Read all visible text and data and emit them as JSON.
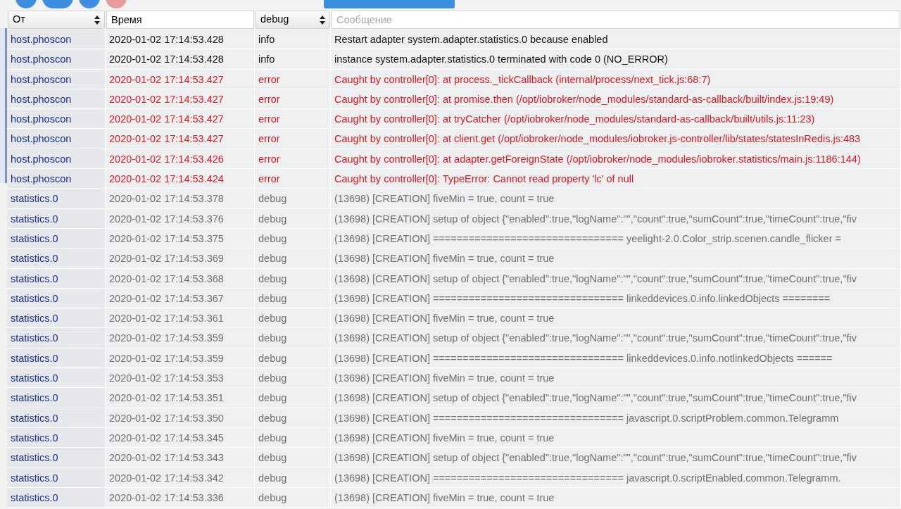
{
  "toolbar": {
    "buttons": [
      {
        "kind": "round",
        "color": "#3c8fe0"
      },
      {
        "kind": "pill",
        "color": "#3c8fe0"
      },
      {
        "kind": "round",
        "color": "#3c8fe0"
      },
      {
        "kind": "round",
        "color": "#e89a9a"
      },
      {
        "kind": "wide",
        "color": "#3c8fe0"
      }
    ]
  },
  "filters": {
    "source": {
      "value": "От"
    },
    "time": {
      "value": "Время"
    },
    "severity": {
      "value": "debug"
    },
    "message": {
      "placeholder": "Сообщение"
    }
  },
  "rows": [
    {
      "source": "host.phoscon",
      "time": "2020-01-02 17:14:53.428",
      "severity": "info",
      "message": "Restart adapter system.adapter.statistics.0 because enabled"
    },
    {
      "source": "host.phoscon",
      "time": "2020-01-02 17:14:53.428",
      "severity": "info",
      "message": "instance system.adapter.statistics.0 terminated with code 0 (NO_ERROR)"
    },
    {
      "source": "host.phoscon",
      "time": "2020-01-02 17:14:53.427",
      "severity": "error",
      "message": "Caught by controller[0]: at process._tickCallback (internal/process/next_tick.js:68:7)"
    },
    {
      "source": "host.phoscon",
      "time": "2020-01-02 17:14:53.427",
      "severity": "error",
      "message": "Caught by controller[0]: at promise.then (/opt/iobroker/node_modules/standard-as-callback/built/index.js:19:49)"
    },
    {
      "source": "host.phoscon",
      "time": "2020-01-02 17:14:53.427",
      "severity": "error",
      "message": "Caught by controller[0]: at tryCatcher (/opt/iobroker/node_modules/standard-as-callback/built/utils.js:11:23)"
    },
    {
      "source": "host.phoscon",
      "time": "2020-01-02 17:14:53.427",
      "severity": "error",
      "message": "Caught by controller[0]: at client.get (/opt/iobroker/node_modules/iobroker.js-controller/lib/states/statesInRedis.js:483"
    },
    {
      "source": "host.phoscon",
      "time": "2020-01-02 17:14:53.426",
      "severity": "error",
      "message": "Caught by controller[0]: at adapter.getForeignState (/opt/iobroker/node_modules/iobroker.statistics/main.js:1186:144)"
    },
    {
      "source": "host.phoscon",
      "time": "2020-01-02 17:14:53.424",
      "severity": "error",
      "message": "Caught by controller[0]: TypeError: Cannot read property 'lc' of null"
    },
    {
      "source": "statistics.0",
      "time": "2020-01-02 17:14:53.378",
      "severity": "debug",
      "message": "(13698) [CREATION] fiveMin = true, count = true"
    },
    {
      "source": "statistics.0",
      "time": "2020-01-02 17:14:53.376",
      "severity": "debug",
      "message": "(13698) [CREATION] setup of object {\"enabled\":true,\"logName\":\"\",\"count\":true,\"sumCount\":true,\"timeCount\":true,\"fiv"
    },
    {
      "source": "statistics.0",
      "time": "2020-01-02 17:14:53.375",
      "severity": "debug",
      "message": "(13698) [CREATION] ================================ yeelight-2.0.Color_strip.scenen.candle_flicker ="
    },
    {
      "source": "statistics.0",
      "time": "2020-01-02 17:14:53.369",
      "severity": "debug",
      "message": "(13698) [CREATION] fiveMin = true, count = true"
    },
    {
      "source": "statistics.0",
      "time": "2020-01-02 17:14:53.368",
      "severity": "debug",
      "message": "(13698) [CREATION] setup of object {\"enabled\":true,\"logName\":\"\",\"count\":true,\"sumCount\":true,\"timeCount\":true,\"fiv"
    },
    {
      "source": "statistics.0",
      "time": "2020-01-02 17:14:53.367",
      "severity": "debug",
      "message": "(13698) [CREATION] ================================ linkeddevices.0.info.linkedObjects ========"
    },
    {
      "source": "statistics.0",
      "time": "2020-01-02 17:14:53.361",
      "severity": "debug",
      "message": "(13698) [CREATION] fiveMin = true, count = true"
    },
    {
      "source": "statistics.0",
      "time": "2020-01-02 17:14:53.359",
      "severity": "debug",
      "message": "(13698) [CREATION] setup of object {\"enabled\":true,\"logName\":\"\",\"count\":true,\"sumCount\":true,\"timeCount\":true,\"fiv"
    },
    {
      "source": "statistics.0",
      "time": "2020-01-02 17:14:53.359",
      "severity": "debug",
      "message": "(13698) [CREATION] ================================ linkeddevices.0.info.notlinkedObjects ======"
    },
    {
      "source": "statistics.0",
      "time": "2020-01-02 17:14:53.353",
      "severity": "debug",
      "message": "(13698) [CREATION] fiveMin = true, count = true"
    },
    {
      "source": "statistics.0",
      "time": "2020-01-02 17:14:53.351",
      "severity": "debug",
      "message": "(13698) [CREATION] setup of object {\"enabled\":true,\"logName\":\"\",\"count\":true,\"sumCount\":true,\"timeCount\":true,\"fiv"
    },
    {
      "source": "statistics.0",
      "time": "2020-01-02 17:14:53.350",
      "severity": "debug",
      "message": "(13698) [CREATION] ================================ javascript.0.scriptProblem.common.Telegramm"
    },
    {
      "source": "statistics.0",
      "time": "2020-01-02 17:14:53.345",
      "severity": "debug",
      "message": "(13698) [CREATION] fiveMin = true, count = true"
    },
    {
      "source": "statistics.0",
      "time": "2020-01-02 17:14:53.343",
      "severity": "debug",
      "message": "(13698) [CREATION] setup of object {\"enabled\":true,\"logName\":\"\",\"count\":true,\"sumCount\":true,\"timeCount\":true,\"fiv"
    },
    {
      "source": "statistics.0",
      "time": "2020-01-02 17:14:53.342",
      "severity": "debug",
      "message": "(13698) [CREATION] ================================ javascript.0.scriptEnabled.common.Telegramm."
    },
    {
      "source": "statistics.0",
      "time": "2020-01-02 17:14:53.336",
      "severity": "debug",
      "message": "(13698) [CREATION] fiveMin = true, count = true"
    }
  ]
}
